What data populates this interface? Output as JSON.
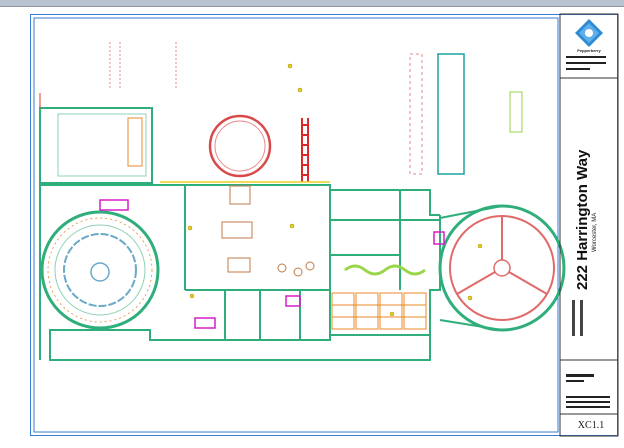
{
  "title_block": {
    "brand": "Pepperberry",
    "address": "222 Harrington Way",
    "city": "Worcester, MA",
    "sheet_number": "XC1.1"
  },
  "colors": {
    "wall": "#2fae7b",
    "wall_dark": "#1f7d57",
    "accent_red": "#e03a3a",
    "accent_magenta": "#d61fc6",
    "accent_yellow": "#e8d21c",
    "accent_orange": "#e88a2a",
    "frame_blue": "#3a7bd5",
    "logo_blue": "#2d8bd6"
  }
}
